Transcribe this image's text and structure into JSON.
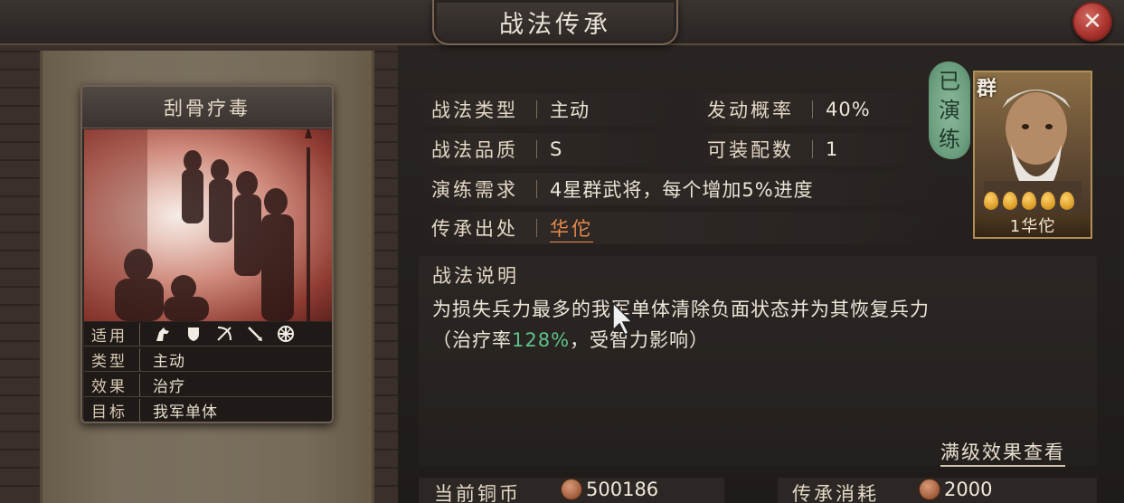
{
  "window": {
    "title": "战法传承"
  },
  "card": {
    "name": "刮骨疗毒",
    "stats": [
      {
        "label": "适用",
        "value": ""
      },
      {
        "label": "类型",
        "value": "主动"
      },
      {
        "label": "效果",
        "value": "治疗"
      },
      {
        "label": "目标",
        "value": "我军单体"
      }
    ],
    "unit_icons": [
      "cavalry-icon",
      "shield-icon",
      "archer-icon",
      "spear-icon",
      "siege-wheel-icon"
    ]
  },
  "info": {
    "type_label": "战法类型",
    "type_value": "主动",
    "chance_label": "发动概率",
    "chance_value": "40%",
    "quality_label": "战法品质",
    "quality_value": "S",
    "equip_label": "可装配数",
    "equip_value": "1",
    "practice_label": "演练需求",
    "practice_value": "4星群武将，每个增加5%进度",
    "source_label": "传承出处",
    "source_value": "华佗"
  },
  "description": {
    "title": "战法说明",
    "line1": "为损失兵力最多的我军单体清除负面状态并为其恢复兵力",
    "line2_pre": "（治疗率",
    "line2_rate": "128%",
    "line2_post": "，受智力影响）"
  },
  "full_effect_link": "满级效果查看",
  "hero": {
    "stamp": [
      "已",
      "演",
      "练"
    ],
    "faction": "群",
    "stars": 5,
    "name": "1华佗"
  },
  "cost": {
    "current_label": "当前铜币",
    "current_value": "500186",
    "consume_label": "传承消耗",
    "consume_value": "2000"
  },
  "colors": {
    "accent_link": "#e98b4b",
    "rate_green": "#5fc28a",
    "close_red": "#a9322c"
  }
}
